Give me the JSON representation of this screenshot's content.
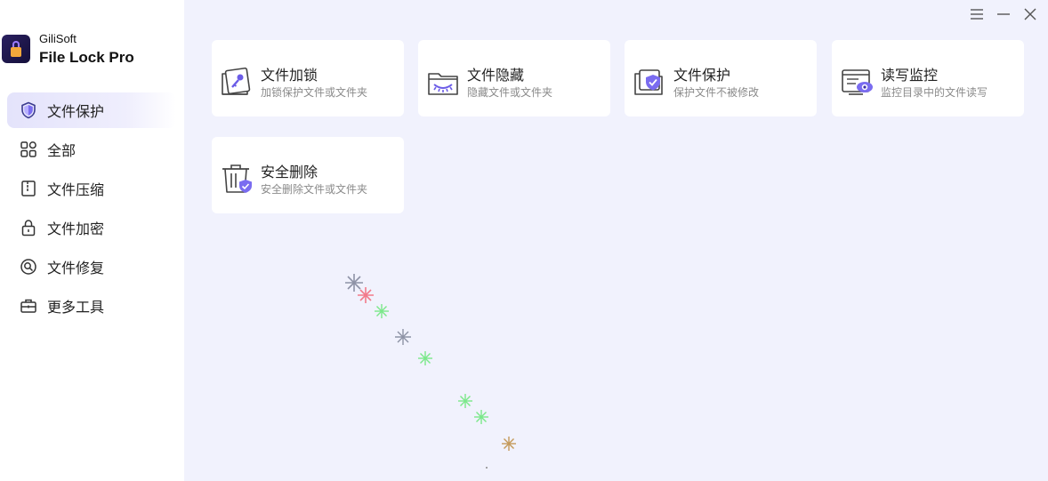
{
  "app": {
    "brand_top": "GiliSoft",
    "brand_main": "File Lock Pro",
    "logo_icon": "lock-logo-icon"
  },
  "sidebar": {
    "items": [
      {
        "label": "文件保护",
        "icon": "shield-icon",
        "active": true
      },
      {
        "label": "全部",
        "icon": "grid-icon",
        "active": false
      },
      {
        "label": "文件压缩",
        "icon": "zip-file-icon",
        "active": false
      },
      {
        "label": "文件加密",
        "icon": "padlock-icon",
        "active": false
      },
      {
        "label": "文件修复",
        "icon": "repair-wrench-icon",
        "active": false
      },
      {
        "label": "更多工具",
        "icon": "toolbox-icon",
        "active": false
      }
    ]
  },
  "window_controls": {
    "icons": [
      "menu-icon",
      "minimize-icon",
      "close-icon"
    ]
  },
  "cards": [
    {
      "title": "文件加锁",
      "subtitle": "加锁保护文件或文件夹",
      "icon": "folder-key-icon"
    },
    {
      "title": "文件隐藏",
      "subtitle": "隐藏文件或文件夹",
      "icon": "folder-eye-closed-icon"
    },
    {
      "title": "文件保护",
      "subtitle": "保护文件不被修改",
      "icon": "folder-shield-icon"
    },
    {
      "title": "读写监控",
      "subtitle": "监控目录中的文件读写",
      "icon": "monitor-eye-icon"
    },
    {
      "title": "安全删除",
      "subtitle": "安全删除文件或文件夹",
      "icon": "trash-shield-icon"
    }
  ],
  "colors": {
    "accent": "#6b5ce7",
    "background": "#f1f2fd",
    "sidebar_bg": "#ffffff",
    "active_bg": "#e4e3fb"
  }
}
